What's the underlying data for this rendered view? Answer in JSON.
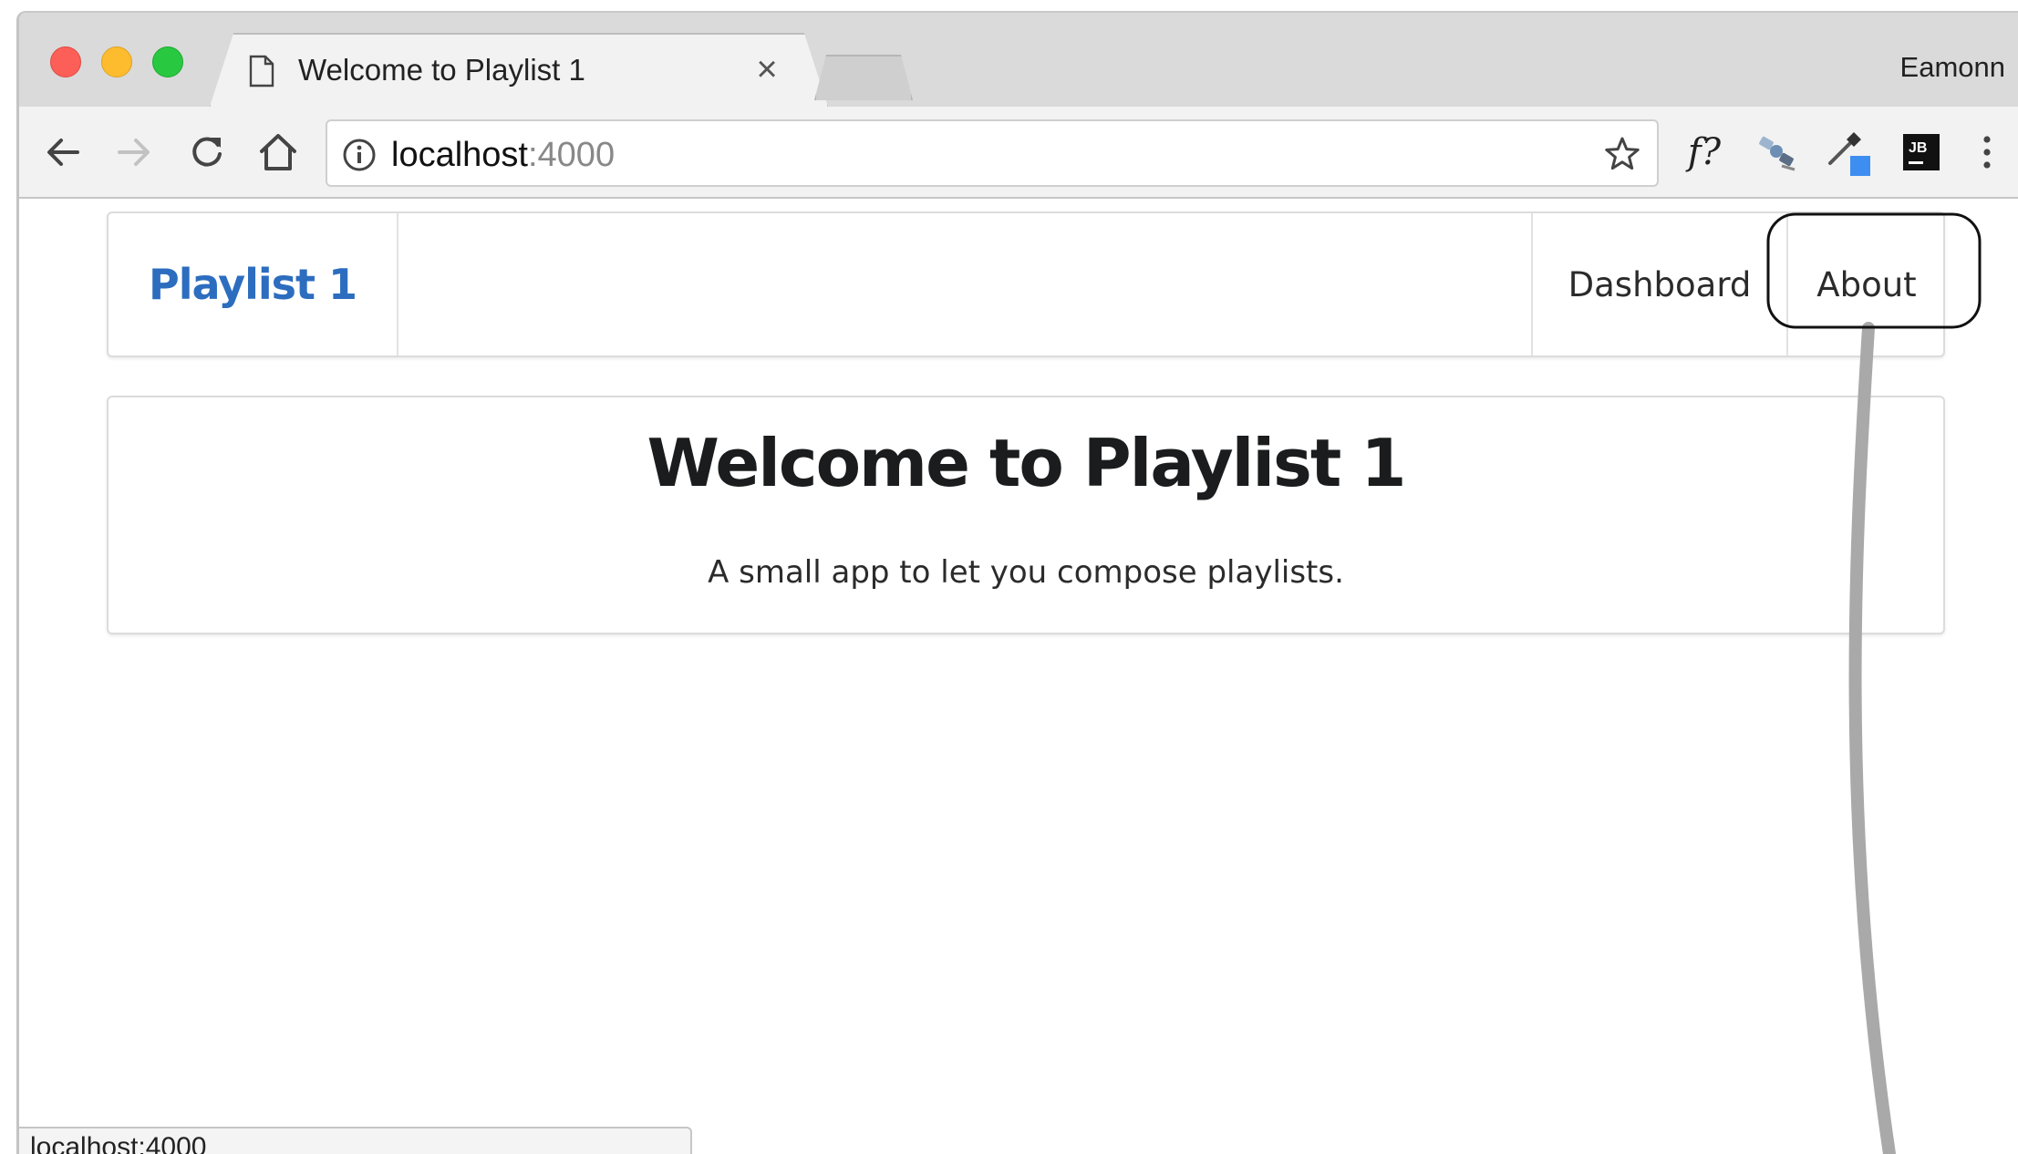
{
  "browser": {
    "tab": {
      "title": "Welcome to Playlist 1",
      "close_symbol": "×",
      "icon": "page-icon"
    },
    "profile_name": "Eamonn",
    "address_bar": {
      "host": "localhost",
      "port": ":4000",
      "icon": "info-icon"
    },
    "toolbar_icons": [
      "back-arrow-icon",
      "forward-arrow-icon",
      "reload-icon",
      "home-icon",
      "star-icon"
    ],
    "extensions": {
      "fquery_label": "f?",
      "icons": [
        "satellite-icon",
        "eyedropper-icon",
        "jetbrains-icon",
        "more-vert-icon"
      ]
    },
    "status_bar_text": "localhost:4000"
  },
  "app": {
    "navbar": {
      "brand": "Playlist 1",
      "links": {
        "dashboard": "Dashboard",
        "about": "About"
      }
    },
    "hero": {
      "title": "Welcome to Playlist 1",
      "subtitle": "A small app to let you compose playlists."
    }
  },
  "colors": {
    "brand": "#2c6dbf",
    "traffic_close": "#fc5f57",
    "traffic_minimize": "#fdbc2e",
    "traffic_maximize": "#28c840",
    "annotation_line": "#a9a9a9"
  }
}
